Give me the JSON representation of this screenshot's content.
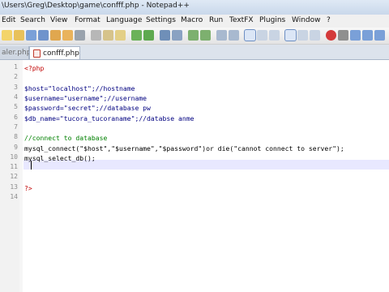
{
  "window": {
    "title": "\\Users\\Greg\\Desktop\\game\\confff.php - Notepad++"
  },
  "menu": [
    "Edit",
    "Search",
    "View",
    "Format",
    "Language",
    "Settings",
    "Macro",
    "Run",
    "TextFX",
    "Plugins",
    "Window",
    "?"
  ],
  "tabs": [
    {
      "label": "aler.php"
    },
    {
      "label": "confff.php"
    }
  ],
  "editor": {
    "lines": [
      {
        "num": "1",
        "text": "<?php"
      },
      {
        "num": "2",
        "text": ""
      },
      {
        "num": "3",
        "text": "$host=\"localhost\";//hostname"
      },
      {
        "num": "4",
        "text": "$username=\"username\";//username"
      },
      {
        "num": "5",
        "text": "$password=\"secret\";//database pw"
      },
      {
        "num": "6",
        "text": "$db_name=\"tucora_tucoraname\";//databse anme"
      },
      {
        "num": "7",
        "text": ""
      },
      {
        "num": "8",
        "text": "//connect to database"
      },
      {
        "num": "9",
        "text": "mysql_connect(\"$host\",\"$username\",\"$password\")or die(\"cannot connect to server\");"
      },
      {
        "num": "10",
        "text": "mysql_select_db();"
      },
      {
        "num": "11",
        "text": ""
      },
      {
        "num": "12",
        "text": ""
      },
      {
        "num": "13",
        "text": ""
      },
      {
        "num": "14",
        "text": "?>"
      }
    ]
  }
}
